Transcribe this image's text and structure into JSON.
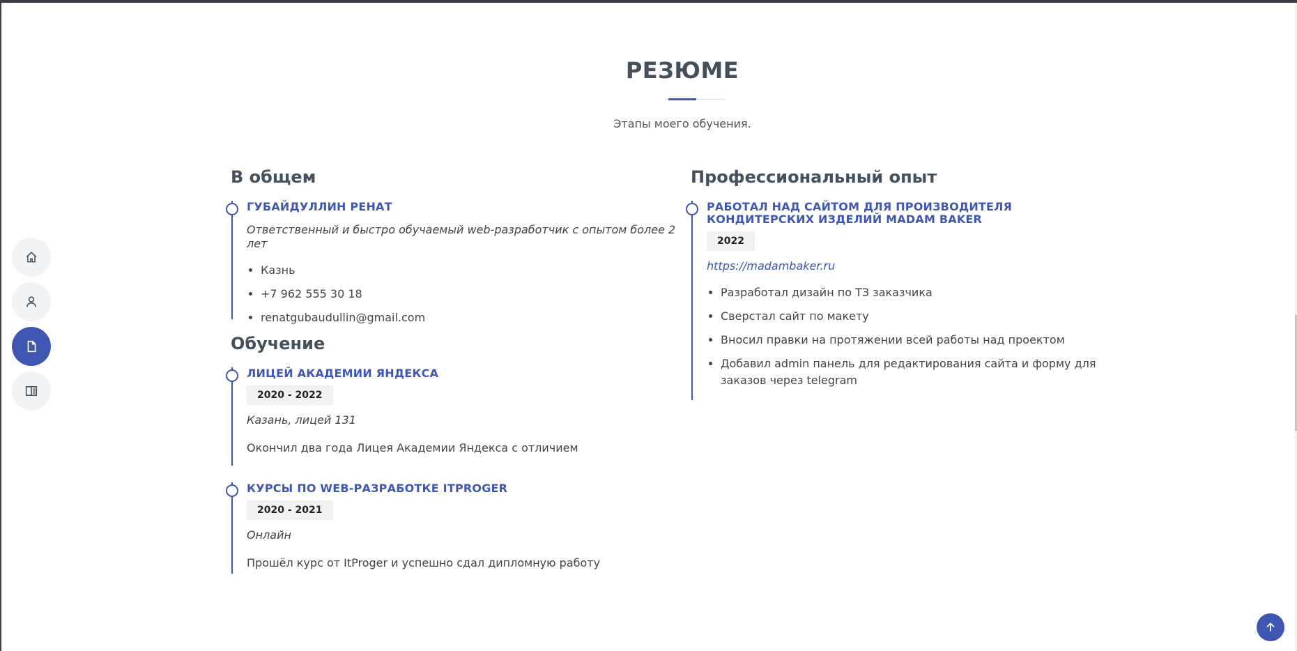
{
  "nav": {
    "items": [
      {
        "icon": "home-icon"
      },
      {
        "icon": "person-icon"
      },
      {
        "icon": "file-icon",
        "active": true
      },
      {
        "icon": "book-icon"
      }
    ]
  },
  "section": {
    "title": "РЕЗЮМЕ",
    "subtitle": "Этапы моего обучения."
  },
  "summary": {
    "heading": "В общем",
    "name": "ГУБАЙДУЛЛИН РЕНАТ",
    "tagline": "Ответственный и быстро обучаемый web-разработчик с опытом более 2 лет",
    "details": [
      "Казнь",
      "+7 962 555 30 18",
      "renatgubaudullin@gmail.com"
    ]
  },
  "education": {
    "heading": "Обучение",
    "items": [
      {
        "title": "ЛИЦЕЙ АКАДЕМИИ ЯНДЕКСА",
        "date": "2020 - 2022",
        "place": "Казань, лицей 131",
        "text": "Окончил два года Лицея Академии Яндекса с отличием"
      },
      {
        "title": "КУРСЫ ПО WEB-РАЗРАБОТКЕ ITPROGER",
        "date": "2020 - 2021",
        "place": "Онлайн",
        "text": "Прошёл курс от ItProger и успешно сдал дипломную работу"
      }
    ]
  },
  "experience": {
    "heading": "Профессиональный опыт",
    "title": "РАБОТАЛ НАД САЙТОМ ДЛЯ ПРОИЗВОДИТЕЛЯ КОНДИТЕРСКИХ ИЗДЕЛИЙ MADAM BAKER",
    "date": "2022",
    "link": "https://madambaker.ru",
    "tasks": [
      "Разработал дизайн по ТЗ заказчика",
      "Сверстал сайт по макету",
      "Вносил правки на протяжении всей работы над проектом",
      "Добавил admin панель для редактирования сайта и форму для заказов через telegram"
    ]
  },
  "colors": {
    "accent": "#3f57b2",
    "heading": "#45505b",
    "nav_bg": "#f2f3f5"
  }
}
